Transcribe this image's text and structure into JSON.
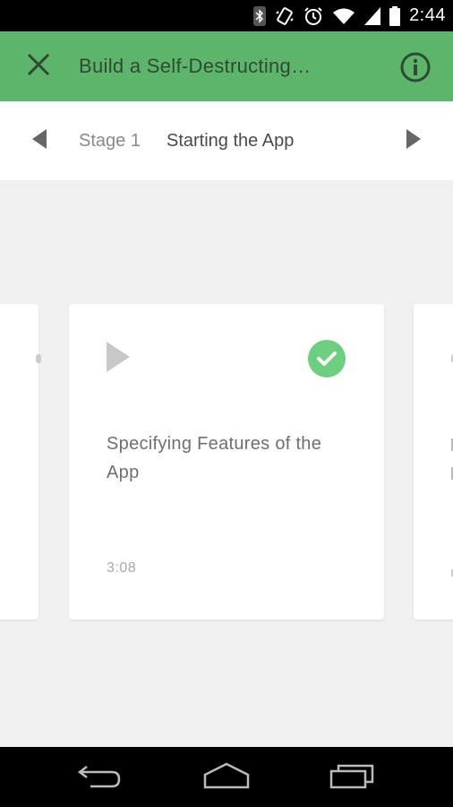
{
  "status_bar": {
    "time": "2:44",
    "icons": [
      "bluetooth-icon",
      "vibrate-icon",
      "alarm-icon",
      "wifi-icon",
      "signal-icon",
      "battery-icon"
    ]
  },
  "app_bar": {
    "title": "Build a Self-Destructing…",
    "close_icon": "close-icon",
    "info_icon": "info-icon",
    "background_color": "#5cb56a"
  },
  "stage_bar": {
    "stage_number": "Stage 1",
    "stage_name": "Starting the App",
    "prev_icon": "chevron-left-icon",
    "next_icon": "chevron-right-icon"
  },
  "cards": {
    "current": {
      "title": "Specifying Features of the App",
      "duration": "3:08",
      "play_icon": "play-icon",
      "status_icon": "check-circle-icon",
      "completed": true,
      "status_color": "#6dce80"
    }
  },
  "nav_bar": {
    "back_icon": "back-icon",
    "home_icon": "home-icon",
    "recents_icon": "recents-icon"
  }
}
